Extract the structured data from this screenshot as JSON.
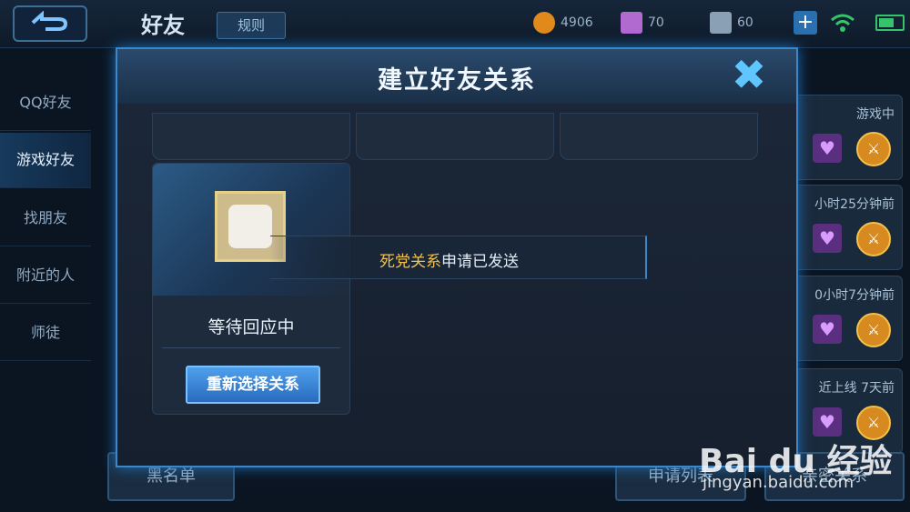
{
  "header": {
    "title": "好友",
    "rules_label": "规则",
    "currency_gold": "4906",
    "currency_diamond": "70",
    "currency_coupon": "60",
    "plus_symbol": "+"
  },
  "sidebar": {
    "items": [
      {
        "label": "QQ好友"
      },
      {
        "label": "游戏好友"
      },
      {
        "label": "找朋友"
      },
      {
        "label": "附近的人"
      },
      {
        "label": "师徒"
      }
    ]
  },
  "friend_list": {
    "rows": [
      {
        "status": "游戏中"
      },
      {
        "status": "小时25分钟前"
      },
      {
        "status": "0小时7分钟前"
      },
      {
        "status": "近上线  7天前"
      }
    ],
    "blacklist_label": "黑名单",
    "requests_label": "申请列表",
    "relations_label": "亲密关系"
  },
  "modal": {
    "title": "建立好友关系",
    "close_symbol": "✖",
    "card": {
      "status": "等待回应中",
      "reselect_label": "重新选择关系"
    },
    "toast": {
      "highlight": "死党关系",
      "rest": "申请已发送"
    }
  },
  "watermark": {
    "logo": "Bai du 经验",
    "url": "jingyan.baidu.com"
  }
}
